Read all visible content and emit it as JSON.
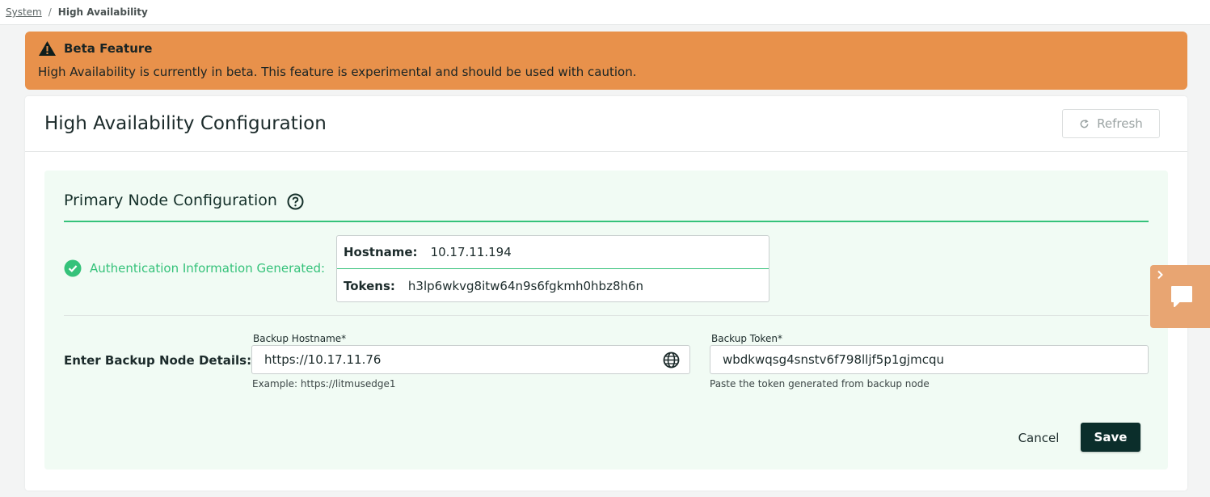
{
  "breadcrumb": {
    "parent": "System",
    "separator": "/",
    "current": "High Availability"
  },
  "banner": {
    "title": "Beta Feature",
    "message": "High Availability is currently in beta. This feature is experimental and should be used with caution.",
    "color": "#e8914b"
  },
  "card": {
    "title": "High Availability Configuration",
    "refresh_label": "Refresh"
  },
  "primary": {
    "title": "Primary Node Configuration",
    "auth_status": "Authentication Information Generated:",
    "hostname_label": "Hostname:",
    "hostname_value": "10.17.11.194",
    "tokens_label": "Tokens:",
    "tokens_value": "h3lp6wkvg8itw64n9s6fgkmh0hbz8h6n",
    "accent_color": "#35c27a"
  },
  "backup": {
    "section_label": "Enter Backup Node Details:",
    "hostname_field_label": "Backup Hostname*",
    "hostname_value": "https://10.17.11.76",
    "hostname_hint": "Example: https://litmusedge1",
    "token_field_label": "Backup Token*",
    "token_value": "wbdkwqsg4snstv6f798lljf5p1gjmcqu",
    "token_hint": "Paste the token generated from backup node"
  },
  "actions": {
    "cancel_label": "Cancel",
    "save_label": "Save",
    "save_color": "#0b2e2b"
  },
  "icons": {
    "warning": "warning-triangle-icon",
    "refresh": "refresh-icon",
    "help": "question-circle-icon",
    "check": "check-circle-icon",
    "globe": "globe-icon",
    "chevron": "chevron-right-icon",
    "chat": "chat-bubble-icon"
  }
}
